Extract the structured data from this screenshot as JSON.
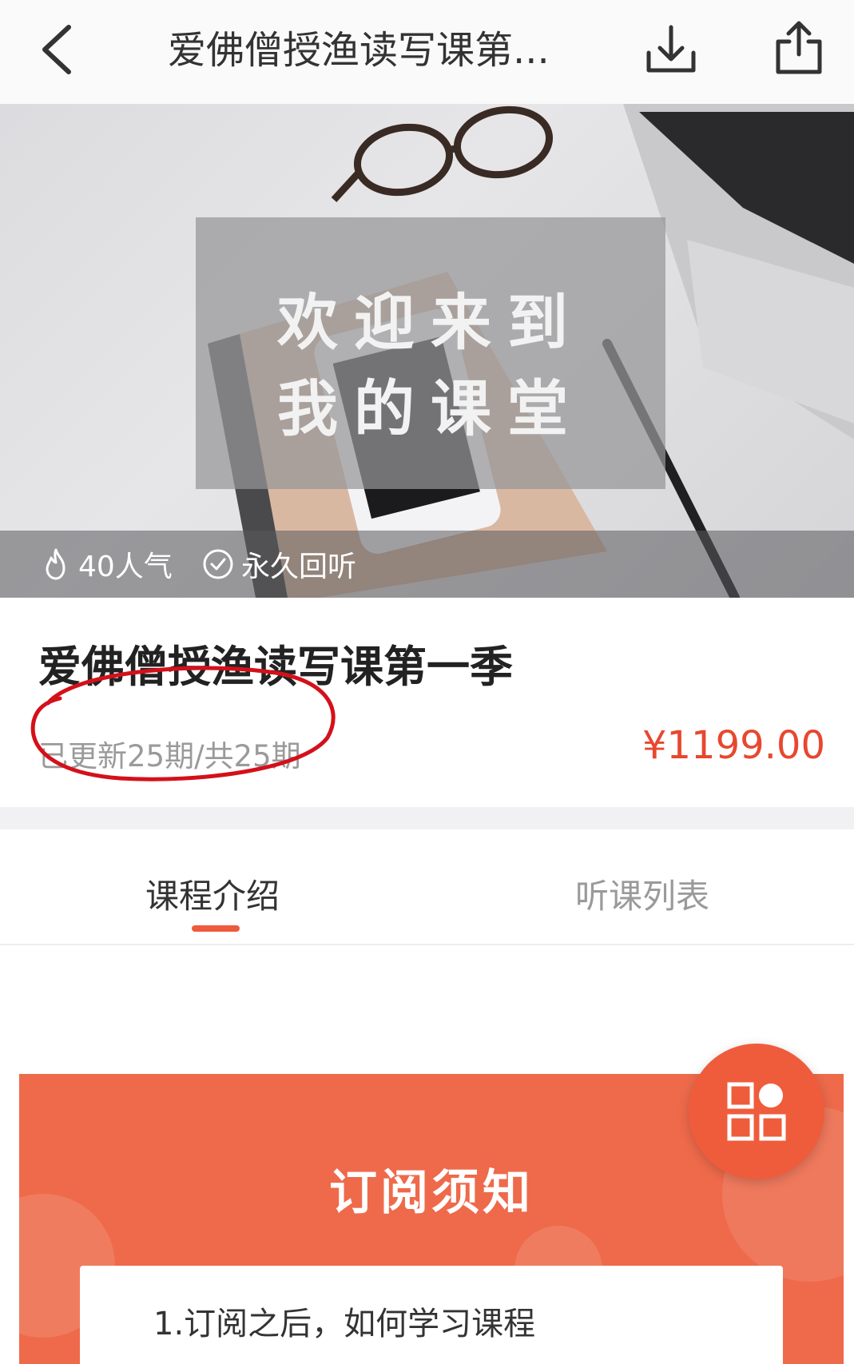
{
  "header": {
    "title": "爱佛僧授渔读写课第...",
    "back_icon": "chevron-left-icon",
    "download_icon": "download-icon",
    "share_icon": "share-icon"
  },
  "banner": {
    "welcome_line1": "欢迎来到",
    "welcome_line2": "我的课堂",
    "popularity": "40人气",
    "replay": "永久回听"
  },
  "course": {
    "title": "爱佛僧授渔读写课第一季",
    "updates": "已更新25期/共25期",
    "price": "¥1199.00",
    "price_color": "#e8472f"
  },
  "tabs": [
    {
      "label": "课程介绍",
      "active": true
    },
    {
      "label": "听课列表",
      "active": false
    }
  ],
  "notice": {
    "title": "订阅须知",
    "first_item": "1.订阅之后，如何学习课程",
    "accent_color": "#ee6a4b"
  },
  "fab": {
    "icon": "grid-menu-icon"
  }
}
